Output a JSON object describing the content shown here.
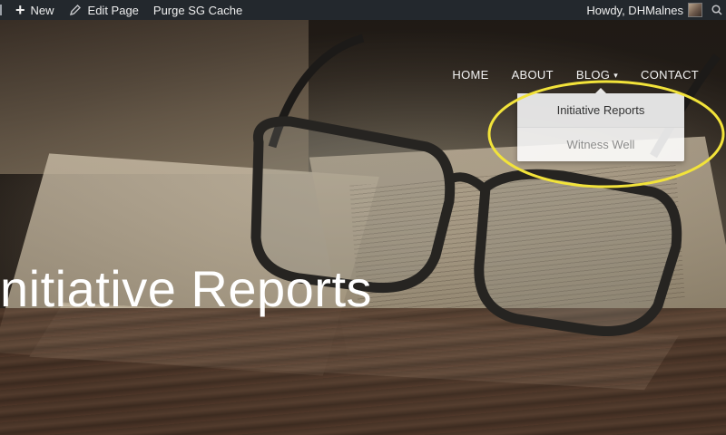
{
  "admin_bar": {
    "new_label": "New",
    "edit_label": "Edit Page",
    "purge_label": "Purge SG Cache",
    "greeting": "Howdy, DHMalnes"
  },
  "nav": {
    "items": [
      {
        "label": "HOME"
      },
      {
        "label": "ABOUT"
      },
      {
        "label": "BLOG"
      },
      {
        "label": "CONTACT"
      }
    ]
  },
  "blog_dropdown": {
    "items": [
      {
        "label": "Initiative Reports"
      },
      {
        "label": "Witness Well"
      }
    ]
  },
  "page": {
    "title": "nitiative Reports"
  },
  "colors": {
    "admin_bar_bg": "#23282d",
    "highlight_circle": "#f2e33a"
  }
}
